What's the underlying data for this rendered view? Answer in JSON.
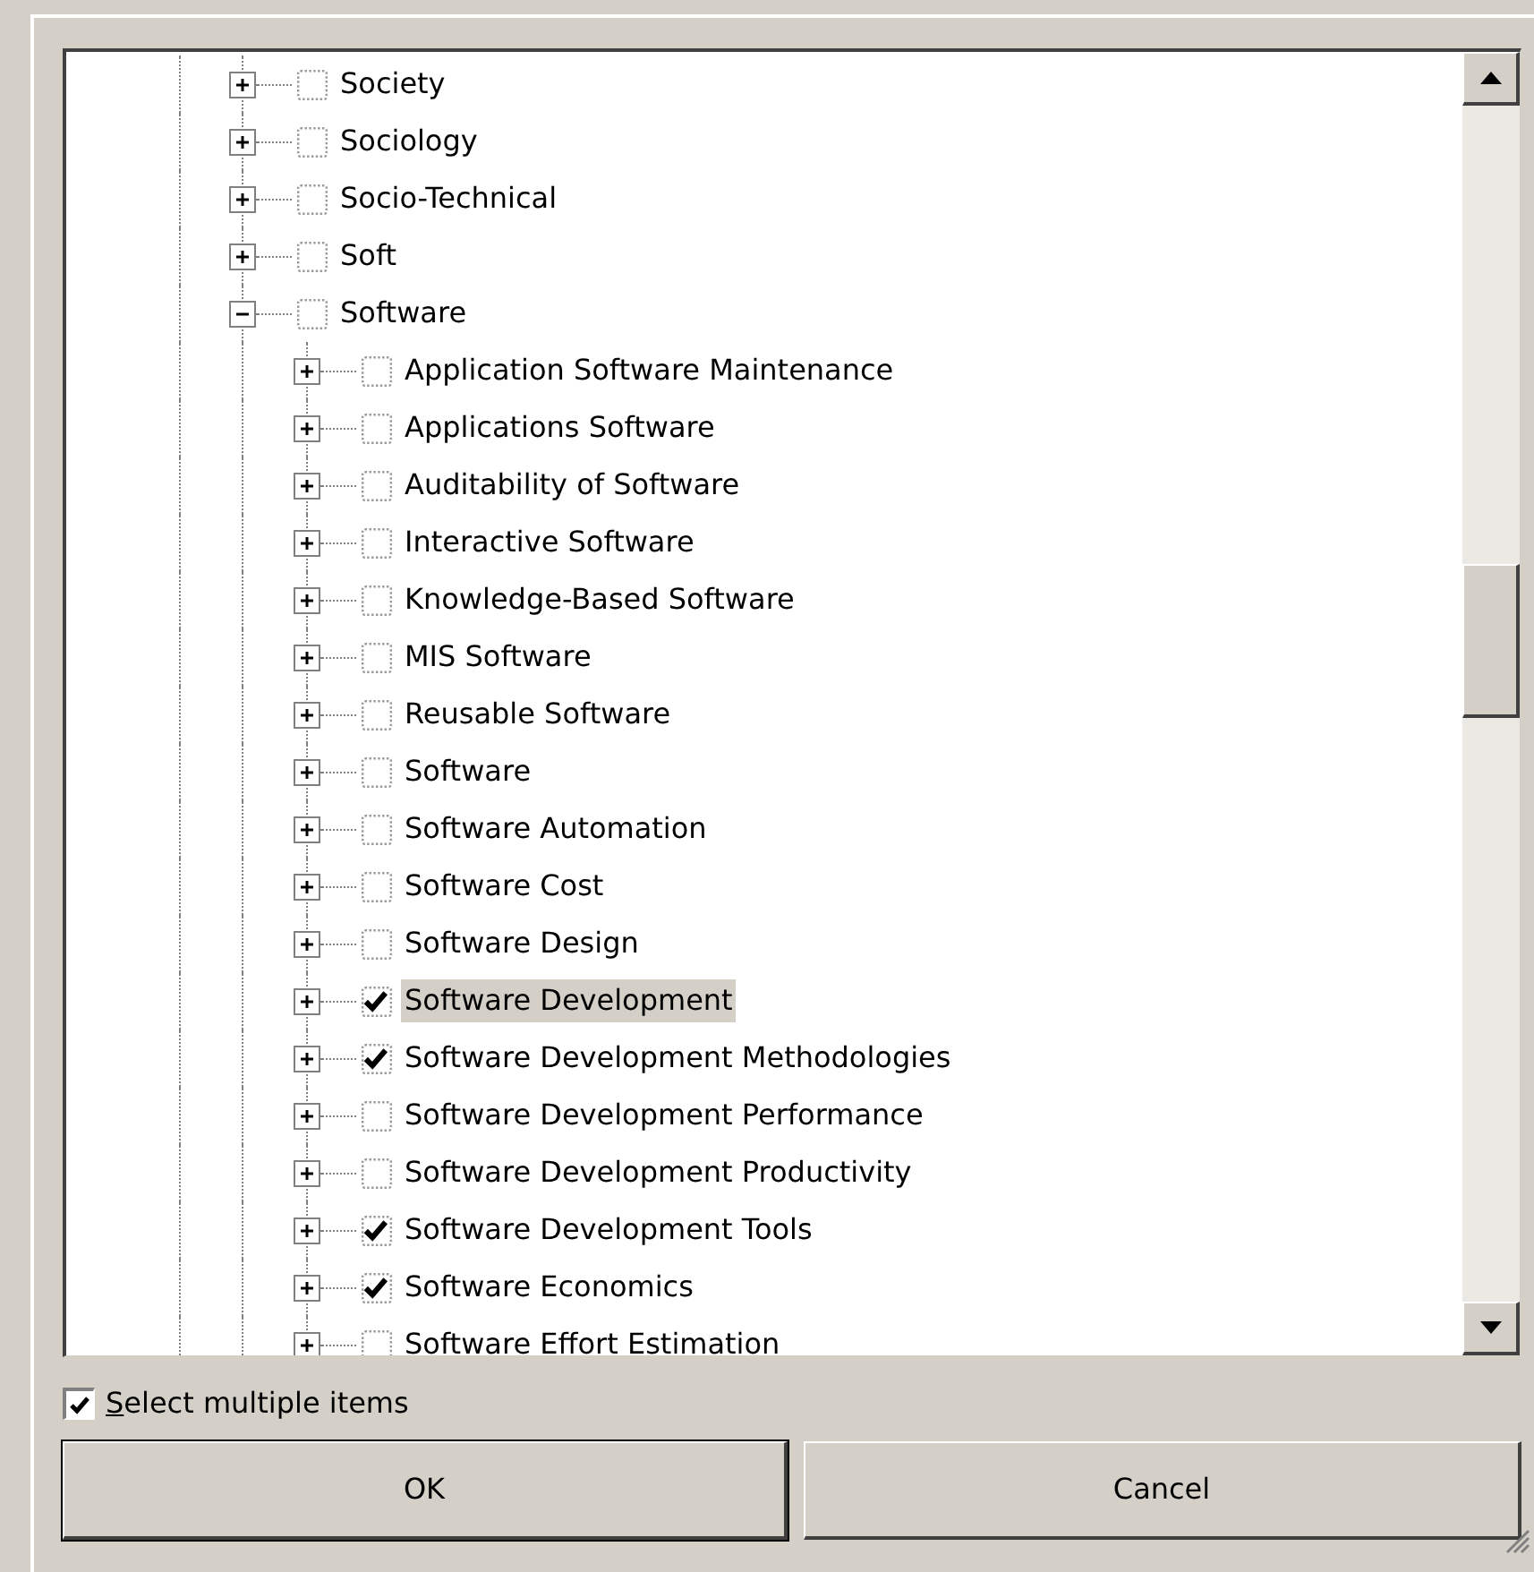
{
  "tree": [
    {
      "label": "Society",
      "expanded": false,
      "checked": false,
      "selected": false
    },
    {
      "label": "Sociology",
      "expanded": false,
      "checked": false,
      "selected": false
    },
    {
      "label": "Socio-Technical",
      "expanded": false,
      "checked": false,
      "selected": false
    },
    {
      "label": "Soft",
      "expanded": false,
      "checked": false,
      "selected": false
    },
    {
      "label": "Software",
      "expanded": true,
      "checked": false,
      "selected": false,
      "children": [
        {
          "label": "Application Software Maintenance",
          "expanded": false,
          "checked": false,
          "selected": false
        },
        {
          "label": "Applications Software",
          "expanded": false,
          "checked": false,
          "selected": false
        },
        {
          "label": "Auditability of Software",
          "expanded": false,
          "checked": false,
          "selected": false
        },
        {
          "label": "Interactive Software",
          "expanded": false,
          "checked": false,
          "selected": false
        },
        {
          "label": "Knowledge-Based Software",
          "expanded": false,
          "checked": false,
          "selected": false
        },
        {
          "label": "MIS Software",
          "expanded": false,
          "checked": false,
          "selected": false
        },
        {
          "label": "Reusable Software",
          "expanded": false,
          "checked": false,
          "selected": false
        },
        {
          "label": "Software",
          "expanded": false,
          "checked": false,
          "selected": false
        },
        {
          "label": "Software Automation",
          "expanded": false,
          "checked": false,
          "selected": false
        },
        {
          "label": "Software Cost",
          "expanded": false,
          "checked": false,
          "selected": false
        },
        {
          "label": "Software Design",
          "expanded": false,
          "checked": false,
          "selected": false
        },
        {
          "label": "Software Development",
          "expanded": false,
          "checked": true,
          "selected": true
        },
        {
          "label": "Software Development Methodologies",
          "expanded": false,
          "checked": true,
          "selected": false
        },
        {
          "label": "Software Development Performance",
          "expanded": false,
          "checked": false,
          "selected": false
        },
        {
          "label": "Software Development Productivity",
          "expanded": false,
          "checked": false,
          "selected": false
        },
        {
          "label": "Software Development Tools",
          "expanded": false,
          "checked": true,
          "selected": false
        },
        {
          "label": "Software Economics",
          "expanded": false,
          "checked": true,
          "selected": false
        },
        {
          "label": "Software Effort Estimation",
          "expanded": false,
          "checked": false,
          "selected": false
        }
      ]
    }
  ],
  "select_multiple": {
    "label": "Select multiple items",
    "checked": true
  },
  "buttons": [
    "OK",
    "Cancel"
  ]
}
